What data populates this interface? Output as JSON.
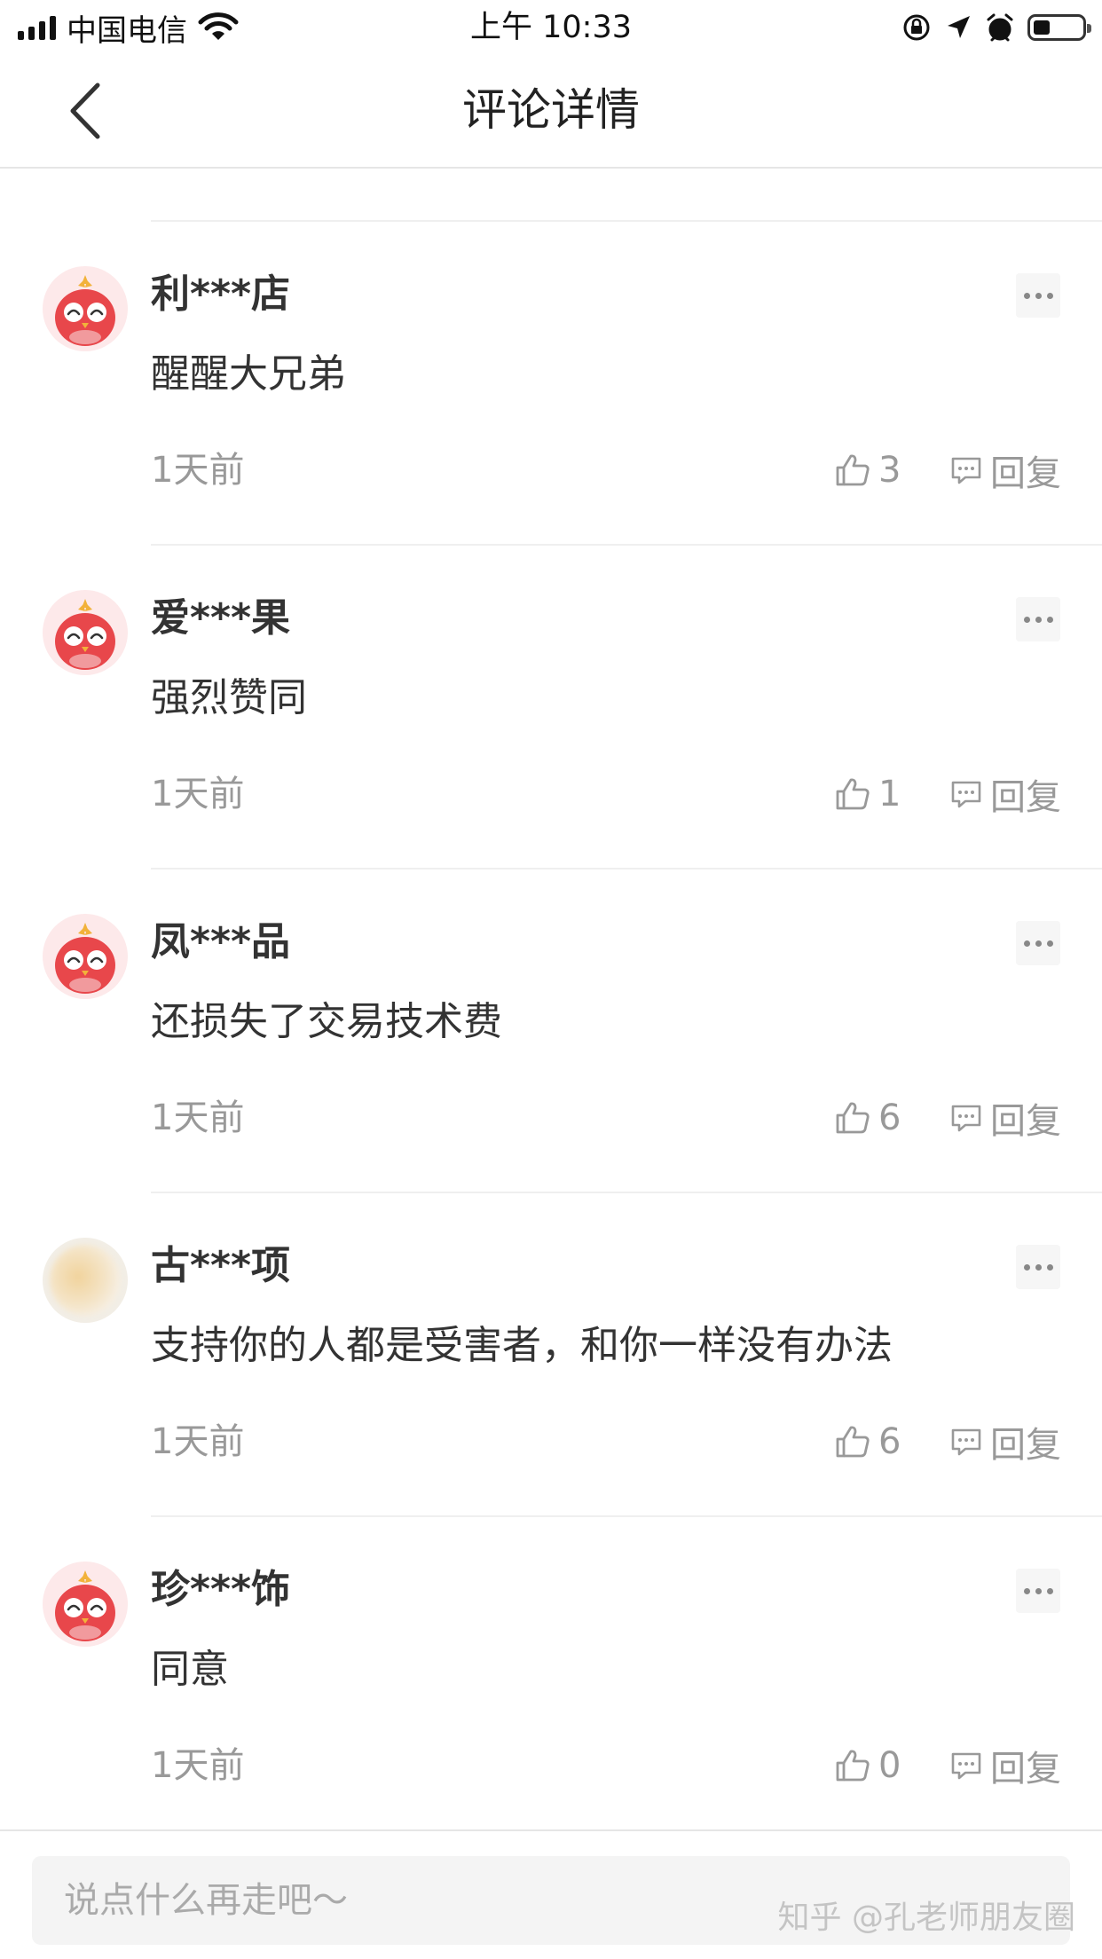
{
  "status_bar": {
    "carrier": "中国电信",
    "time": "上午 10:33",
    "battery_level": 0.35
  },
  "navbar": {
    "title": "评论详情"
  },
  "comments": [
    {
      "username": "利***店",
      "content": "醒醒大兄弟",
      "time": "1天前",
      "likes": "3",
      "reply_label": "回复",
      "avatar": "mascot-avatar"
    },
    {
      "username": "爱***果",
      "content": "强烈赞同",
      "time": "1天前",
      "likes": "1",
      "reply_label": "回复",
      "avatar": "mascot-avatar"
    },
    {
      "username": "凤***品",
      "content": "还损失了交易技术费",
      "time": "1天前",
      "likes": "6",
      "reply_label": "回复",
      "avatar": "mascot-avatar"
    },
    {
      "username": "古***项",
      "content": "支持你的人都是受害者，和你一样没有办法",
      "time": "1天前",
      "likes": "6",
      "reply_label": "回复",
      "avatar": "blurred-avatar"
    },
    {
      "username": "珍***饰",
      "content": "同意",
      "time": "1天前",
      "likes": "0",
      "reply_label": "回复",
      "avatar": "mascot-avatar"
    }
  ],
  "input": {
    "placeholder": "说点什么再走吧～"
  },
  "watermark": "知乎 @孔老师朋友圈",
  "colors": {
    "avatar_red": "#e8474b",
    "text_primary": "#333333",
    "text_secondary": "#999999"
  }
}
